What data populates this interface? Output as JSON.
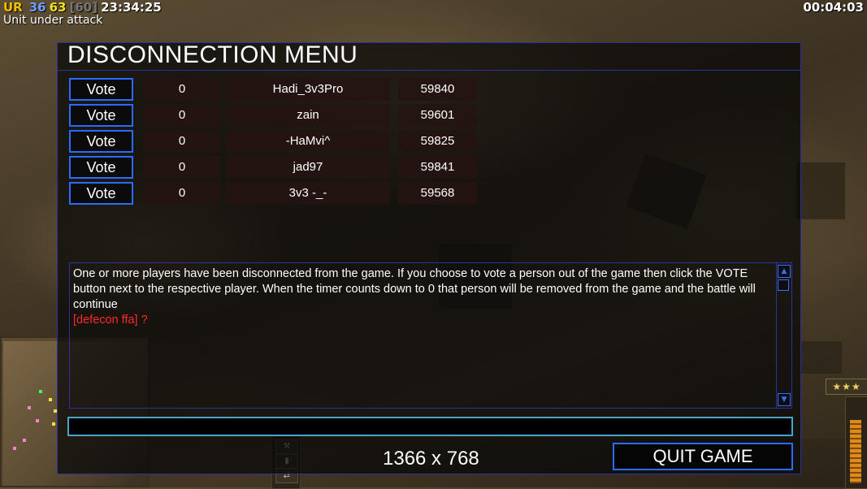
{
  "hud": {
    "ur_label": "UR",
    "value_a": "36",
    "value_b": "63",
    "value_c": "[60]",
    "clock": "23:34:25",
    "alert": "Unit under attack",
    "timer": "00:04:03"
  },
  "dialog": {
    "title": "DISCONNECTION MENU",
    "vote_label": "Vote",
    "players": [
      {
        "count": "0",
        "name": "Hadi_3v3Pro",
        "id": "59840"
      },
      {
        "count": "0",
        "name": "zain",
        "id": "59601"
      },
      {
        "count": "0",
        "name": "-HaMvi^",
        "id": "59825"
      },
      {
        "count": "0",
        "name": "jad97",
        "id": "59841"
      },
      {
        "count": "0",
        "name": "3v3 -_-",
        "id": "59568"
      }
    ],
    "message": "One or more players have been disconnected from the game. If you choose to vote a person out of the game then click the VOTE button next to the respective player. When the timer counts down to 0 that person will be removed from the game and the battle will continue",
    "chat_line": "[defecon ffa] ?",
    "chat_input_value": "",
    "resolution_text": "1366 x 768",
    "quit_label": "QUIT GAME"
  },
  "side": {
    "stars": "★★★"
  },
  "colors": {
    "accent_blue": "#2b6cff",
    "frame_blue": "#2a32a0",
    "chat_red": "#ff2a2a"
  }
}
